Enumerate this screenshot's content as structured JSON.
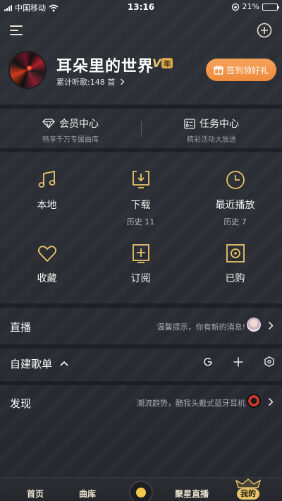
{
  "status_bar": {
    "carrier": "中国移动",
    "time": "13:16",
    "battery": "21%"
  },
  "profile": {
    "username": "耳朵里的世界",
    "vip_label": "V",
    "vip_year": "年",
    "listen_count": "累计听歌:148 首",
    "checkin_label": "签到领好礼"
  },
  "member_bar": {
    "vip_center": {
      "title": "会员中心",
      "subtitle": "畅享千万专属曲库"
    },
    "task_center": {
      "title": "任务中心",
      "subtitle": "精彩活动大放送"
    }
  },
  "grid": [
    {
      "label": "本地",
      "icon": "music-note-icon",
      "sub": ""
    },
    {
      "label": "下载",
      "icon": "download-icon",
      "sub": "历史 11"
    },
    {
      "label": "最近播放",
      "icon": "clock-icon",
      "sub": "历史 7"
    },
    {
      "label": "收藏",
      "icon": "heart-icon",
      "sub": ""
    },
    {
      "label": "订阅",
      "icon": "subscribe-icon",
      "sub": ""
    },
    {
      "label": "已购",
      "icon": "purchased-icon",
      "sub": ""
    }
  ],
  "rows": {
    "live": {
      "title": "直播",
      "hint": "温馨提示，你有新的消息!"
    },
    "playlist": {
      "title": "自建歌单"
    },
    "discover": {
      "title": "发现",
      "hint": "潮流趋势，酷我头戴式蓝牙耳机"
    }
  },
  "tabbar": {
    "home": "首页",
    "library": "曲库",
    "star_live": "聚星直播",
    "mine": "我的"
  },
  "colors": {
    "accent_gold": "#e8c56b",
    "checkin_orange": "#f0903f",
    "background": "#2a2d33"
  }
}
